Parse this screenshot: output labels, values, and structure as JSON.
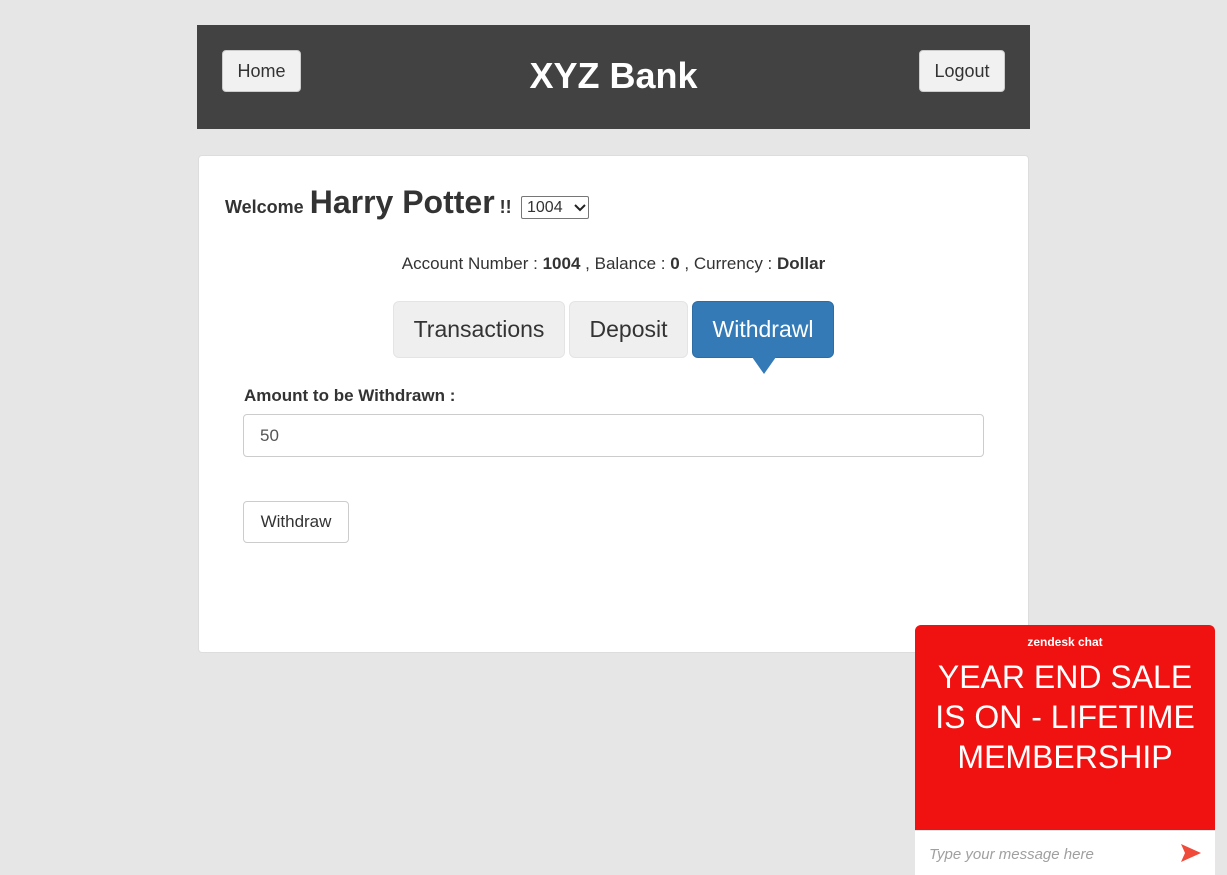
{
  "header": {
    "title": "XYZ Bank",
    "home_label": "Home",
    "logout_label": "Logout"
  },
  "welcome": {
    "label": "Welcome",
    "name": "Harry Potter",
    "suffix": "!!"
  },
  "account_select": {
    "selected": "1004"
  },
  "account_info": {
    "number_label": "Account Number :",
    "number": "1004",
    "balance_label": ", Balance :",
    "balance": "0",
    "currency_label": ", Currency :",
    "currency": "Dollar"
  },
  "tabs": [
    {
      "label": "Transactions",
      "active": false
    },
    {
      "label": "Deposit",
      "active": false
    },
    {
      "label": "Withdrawl",
      "active": true
    }
  ],
  "withdraw_form": {
    "amount_label": "Amount to be Withdrawn :",
    "amount_value": "50",
    "submit_label": "Withdraw"
  },
  "chat_widget": {
    "brand": "zendesk chat",
    "promo": "YEAR END SALE IS ON - LIFETIME MEMBERSHIP",
    "placeholder": "Type your message here",
    "send_icon": "send-icon"
  },
  "colors": {
    "header_bg": "#424242",
    "active_tab": "#337ab7",
    "chat_bg": "#f01111",
    "send_icon": "#f04a3a"
  }
}
